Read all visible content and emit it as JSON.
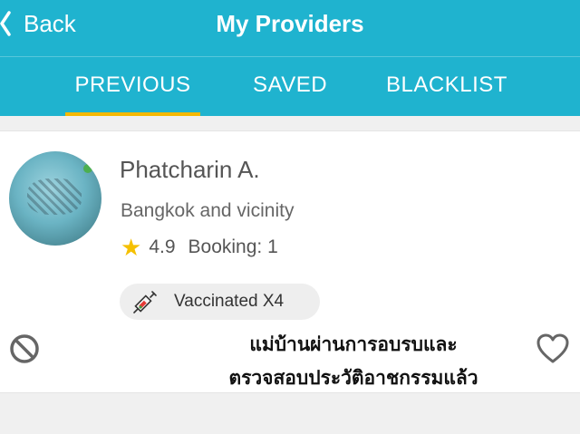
{
  "header": {
    "back_label": "Back",
    "title": "My Providers",
    "tabs": [
      {
        "label": "PREVIOUS",
        "active": true
      },
      {
        "label": "SAVED",
        "active": false
      },
      {
        "label": "BLACKLIST",
        "active": false
      }
    ]
  },
  "provider": {
    "name": "Phatcharin A.",
    "location": "Bangkok and vicinity",
    "rating": "4.9",
    "booking": "Booking: 1",
    "badge": {
      "icon": "syringe-icon",
      "label": "Vaccinated X4"
    },
    "actions": {
      "left": "block-icon",
      "right": "heart-icon"
    }
  },
  "overlay_caption": {
    "line1": "แม่บ้านผ่านการอบรบและ",
    "line2": "ตรวจสอบประวัติอาชกรรมแล้ว"
  },
  "colors": {
    "header_bg": "#1fb3cf",
    "tab_indicator": "#f5b800",
    "star": "#f5c000"
  }
}
